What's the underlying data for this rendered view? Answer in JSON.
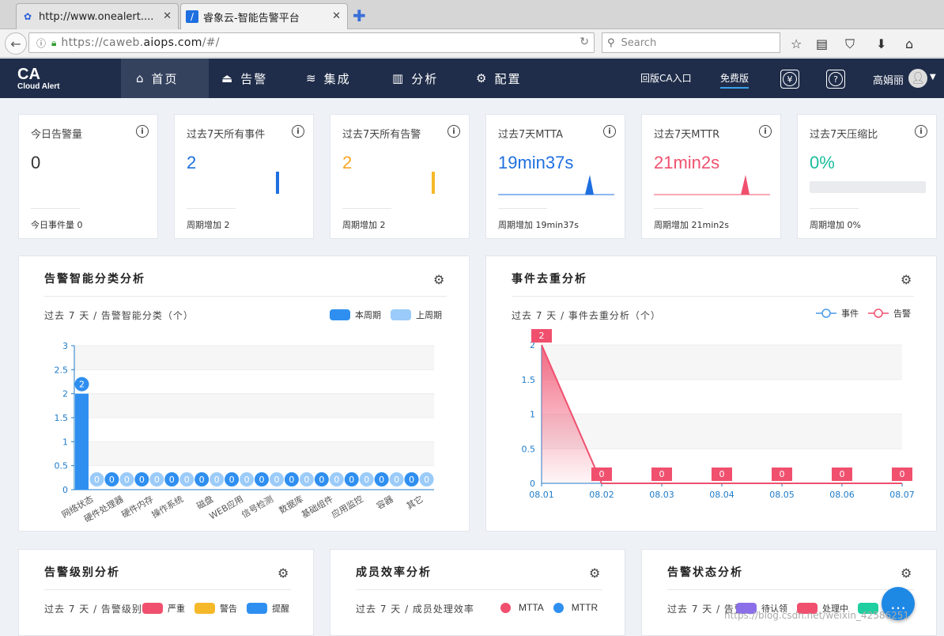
{
  "browser": {
    "tabs": [
      {
        "label": "http://www.onealert...."
      },
      {
        "label": "睿象云-智能告警平台"
      }
    ],
    "url": {
      "prefix": "https://caweb.",
      "domain": "aiops.com",
      "suffix": "/#/"
    },
    "search_placeholder": "Search"
  },
  "app": {
    "logo_big": "CA",
    "logo_small": "Cloud Alert",
    "menu": [
      {
        "label": "首页",
        "icon": "home-icon"
      },
      {
        "label": "告警",
        "icon": "siren-icon"
      },
      {
        "label": "集成",
        "icon": "layers-icon"
      },
      {
        "label": "分析",
        "icon": "bar-chart-icon"
      },
      {
        "label": "配置",
        "icon": "gear-icon"
      }
    ],
    "old_version": "回版CA入口",
    "free_version": "免费版",
    "yuan": "¥",
    "help": "?",
    "user": "高娟丽"
  },
  "kpis": [
    {
      "title": "今日告警量",
      "value": "0",
      "foot": "今日事件量 0",
      "color": "#333333"
    },
    {
      "title": "过去7天所有事件",
      "value": "2",
      "foot": "周期增加 2",
      "color": "#1e6fe0"
    },
    {
      "title": "过去7天所有告警",
      "value": "2",
      "foot": "周期增加 2",
      "color": "#f5a623"
    },
    {
      "title": "过去7天MTTA",
      "value": "19min37s",
      "foot": "周期增加 19min37s",
      "color": "#1e6fe0"
    },
    {
      "title": "过去7天MTTR",
      "value": "21min2s",
      "foot": "周期增加 21min2s",
      "color": "#f0506e"
    },
    {
      "title": "过去7天压缩比",
      "value": "0%",
      "foot": "周期增加 0%",
      "color": "#1abc9c"
    }
  ],
  "panels": {
    "classify": {
      "title": "告警智能分类分析",
      "subtitle": "过去 7 天 / 告警智能分类（个）",
      "legend": [
        "本周期",
        "上周期"
      ]
    },
    "dedupe": {
      "title": "事件去重分析",
      "subtitle": "过去 7 天 / 事件去重分析（个）",
      "legend": [
        "事件",
        "告警"
      ]
    },
    "level": {
      "title": "告警级别分析",
      "subtitle": "过去 7 天 / 告警级别",
      "legend": [
        "严重",
        "警告",
        "提醒"
      ]
    },
    "efficiency": {
      "title": "成员效率分析",
      "subtitle": "过去 7 天 / 成员处理效率",
      "legend": [
        "MTTA",
        "MTTR"
      ]
    },
    "status": {
      "title": "告警状态分析",
      "subtitle": "过去 7 天 / 告警状",
      "legend": [
        "待认领",
        "处理中",
        ""
      ]
    }
  },
  "colors": {
    "current": "#2f8ff0",
    "previous": "#9bcbf8",
    "events": "#4a9be8",
    "alerts": "#f0506e",
    "severe": "#f0506e",
    "warning": "#f5b829",
    "remind": "#2f8ff0",
    "pending": "#8a6fe8",
    "processing": "#f0506e",
    "other": "#1fcf9f"
  },
  "chart_data": [
    {
      "type": "bar",
      "categories": [
        "网络状态",
        "硬件处理器",
        "硬件内存",
        "操作系统",
        "磁盘",
        "WEB应用",
        "信号检测",
        "数据库",
        "基础组件",
        "应用监控",
        "容器",
        "其它"
      ],
      "series": [
        {
          "name": "本周期",
          "values": [
            2,
            0,
            0,
            0,
            0,
            0,
            0,
            0,
            0,
            0,
            0,
            0
          ]
        },
        {
          "name": "上周期",
          "values": [
            0,
            0,
            0,
            0,
            0,
            0,
            0,
            0,
            0,
            0,
            0,
            0
          ]
        }
      ],
      "yticks": [
        "0",
        "0.5",
        "1",
        "1.5",
        "2",
        "2.5",
        "3"
      ],
      "ylim": [
        0,
        3
      ]
    },
    {
      "type": "area",
      "x": [
        "08.01",
        "08.02",
        "08.03",
        "08.04",
        "08.05",
        "08.06",
        "08.07"
      ],
      "series": [
        {
          "name": "事件",
          "values": [
            2,
            0,
            0,
            0,
            0,
            0,
            0
          ]
        },
        {
          "name": "告警",
          "values": [
            2,
            0,
            0,
            0,
            0,
            0,
            0
          ]
        }
      ],
      "yticks": [
        "0",
        "0.5",
        "1",
        "1.5",
        "2"
      ],
      "ylim": [
        0,
        2
      ]
    }
  ],
  "watermark": "https://blog.csdn.net/weixin_42586251",
  "chat_label": "…"
}
